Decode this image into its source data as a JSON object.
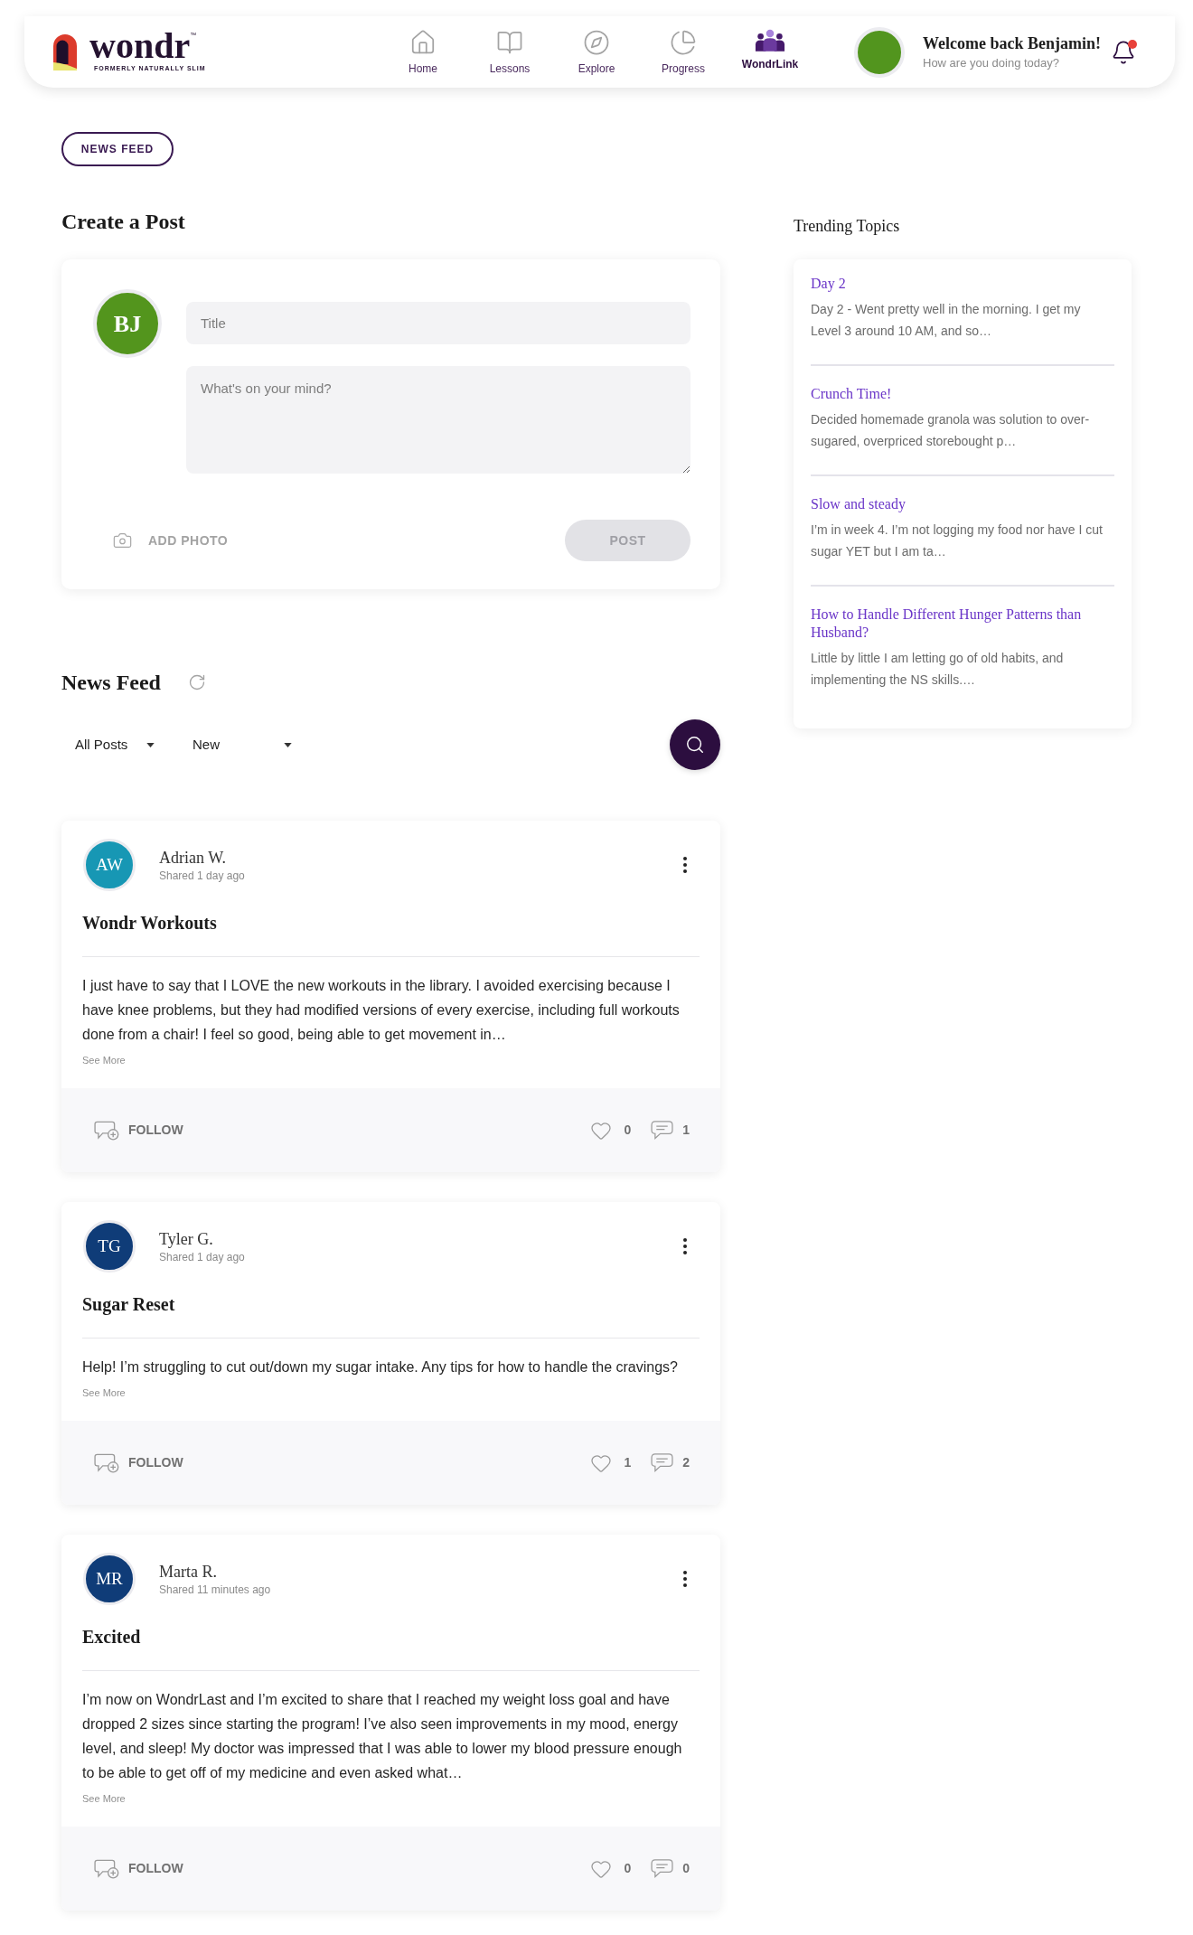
{
  "header": {
    "logo": {
      "wordmark": "wondr",
      "trademark": "™",
      "tagline": "FORMERLY NATURALLY SLIM"
    },
    "nav": [
      {
        "label": "Home",
        "selected": false
      },
      {
        "label": "Lessons",
        "selected": false
      },
      {
        "label": "Explore",
        "selected": false
      },
      {
        "label": "Progress",
        "selected": false
      },
      {
        "label": "WondrLink",
        "selected": true
      }
    ],
    "user": {
      "greeting": "Welcome back Benjamin!",
      "subtitle": "How are you doing today?"
    },
    "notifications": {
      "unread": true
    }
  },
  "section_tab": {
    "label": "NEWS FEED"
  },
  "create_post": {
    "heading": "Create a Post",
    "avatar_initials": "BJ",
    "title_field": {
      "placeholder": "Title"
    },
    "body_field": {
      "placeholder": "What's on your mind?"
    },
    "add_photo": "ADD PHOTO",
    "post_button": {
      "label": "POST",
      "disabled": true
    }
  },
  "news_feed": {
    "heading": "News Feed",
    "filters": [
      {
        "value": "All Posts"
      },
      {
        "value": "New"
      }
    ],
    "posts": [
      {
        "initials": "AW",
        "color": "#1797b4",
        "author": "Adrian W.",
        "time": "Shared 1 day ago",
        "title": "Wondr Workouts",
        "body": "I just have to say that I LOVE the new workouts in the library. I avoided exercising because I have knee problems, but they had modified versions of every exercise, including full workouts done from a chair! I feel so good, being able to get movement in…",
        "see_more": "See More",
        "follow": "FOLLOW",
        "likes": "0",
        "comments": "1"
      },
      {
        "initials": "TG",
        "color": "#0f3c78",
        "author": "Tyler G.",
        "time": "Shared 1 day ago",
        "title": "Sugar Reset",
        "body": "Help! I’m struggling to cut out/down my sugar intake. Any tips for how to handle the cravings?",
        "see_more": "See More",
        "follow": "FOLLOW",
        "likes": "1",
        "comments": "2"
      },
      {
        "initials": "MR",
        "color": "#0f3c78",
        "author": "Marta R.",
        "time": "Shared 11 minutes ago",
        "title": "Excited",
        "body": "I’m now on WondrLast and I’m excited to share that I reached my weight loss goal and have dropped 2 sizes since starting the program! I’ve also seen improvements in my mood, energy level, and sleep! My doctor was impressed that I was able to lower my blood pressure enough to be able to get off of my medicine and even asked what…",
        "see_more": "See More",
        "follow": "FOLLOW",
        "likes": "0",
        "comments": "0"
      }
    ]
  },
  "trending": {
    "heading": "Trending Topics",
    "topics": [
      {
        "title": "Day 2",
        "excerpt": "Day 2 - Went pretty well in the morning. I get my Level 3 around 10 AM, and so…"
      },
      {
        "title": "Crunch Time!",
        "excerpt": "Decided homemade granola was solution to over-sugared, overpriced storebought p…"
      },
      {
        "title": "Slow and steady",
        "excerpt": "I’m in week 4. I’m not logging my food nor have I cut sugar YET but I am ta…"
      },
      {
        "title": "How to Handle Different Hunger Patterns than Husband?",
        "excerpt": "Little by little I am letting go of old habits, and implementing the NS skills.…"
      }
    ]
  }
}
